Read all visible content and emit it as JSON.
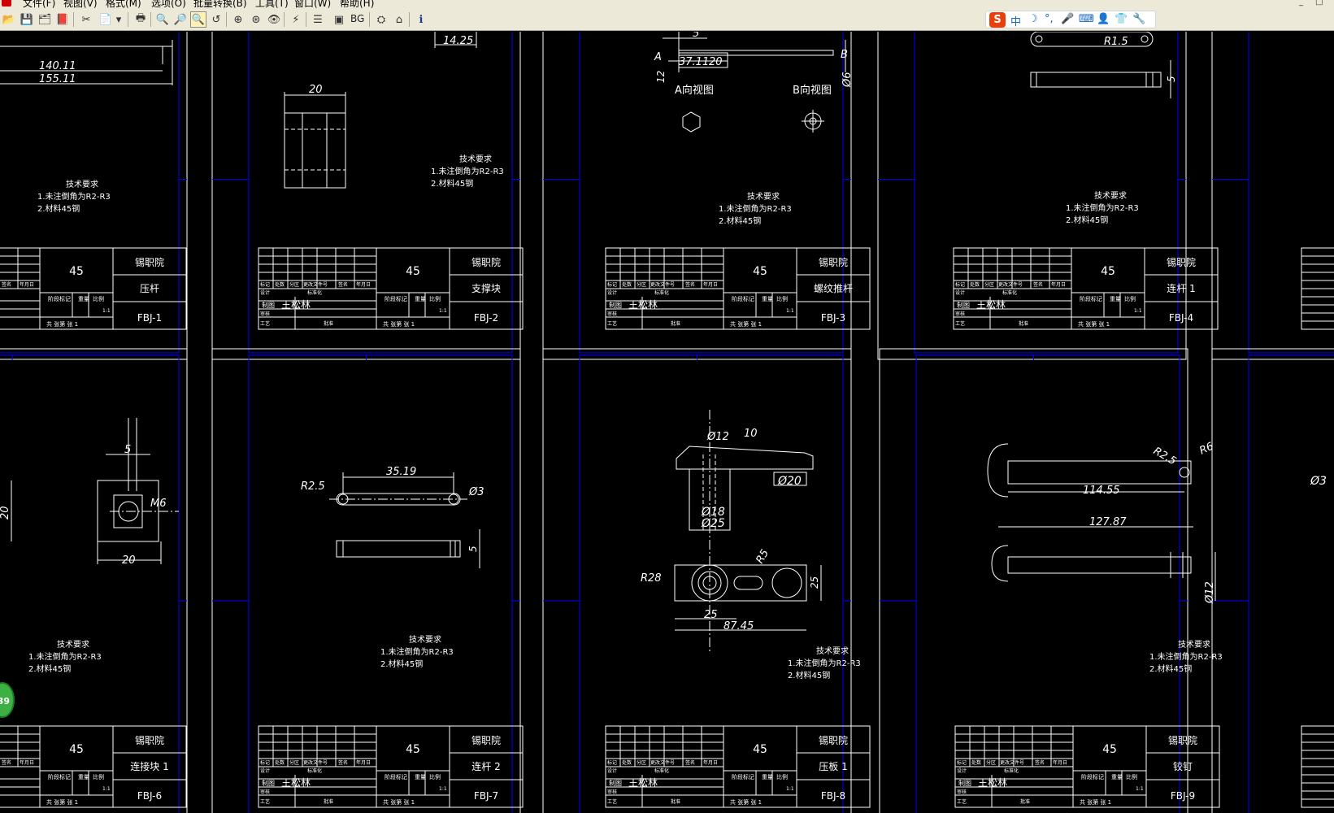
{
  "menu": {
    "items": [
      "文件(F)",
      "视图(V)",
      "格式(M)",
      "选项(O)",
      "批量转换(B)",
      "工具(T)",
      "窗口(W)",
      "帮助(H)"
    ],
    "window_controls": [
      "_",
      "□"
    ]
  },
  "toolbar": {
    "buttons": [
      {
        "name": "open-icon",
        "glyph": "📂"
      },
      {
        "name": "save-icon",
        "glyph": "💾"
      },
      {
        "name": "save-as-icon",
        "glyph": "🗂"
      },
      {
        "name": "export-icon",
        "glyph": "📕"
      },
      {
        "name": "convert-icon",
        "glyph": "✂"
      },
      {
        "name": "batch-icon",
        "glyph": "📄"
      },
      {
        "name": "dropdown-icon",
        "glyph": "▾"
      },
      {
        "name": "print-icon",
        "glyph": "🖶"
      },
      {
        "name": "zoom-out-icon",
        "glyph": "🔍"
      },
      {
        "name": "zoom-in-icon",
        "glyph": "🔎"
      },
      {
        "name": "zoom-window-icon",
        "glyph": "🔍"
      },
      {
        "name": "pan-icon",
        "glyph": "↺"
      },
      {
        "name": "zoom-extents-icon",
        "glyph": "⊕"
      },
      {
        "name": "zoom-previous-icon",
        "glyph": "⊛"
      },
      {
        "name": "view-icon",
        "glyph": "👁"
      },
      {
        "name": "measure-icon",
        "glyph": "⚡"
      },
      {
        "name": "layers-icon",
        "glyph": "☰"
      },
      {
        "name": "frame-icon",
        "glyph": "▣"
      },
      {
        "name": "bg-icon",
        "glyph": "BG"
      },
      {
        "name": "tools-icon",
        "glyph": "⛭"
      },
      {
        "name": "home-icon",
        "glyph": "⌂"
      },
      {
        "name": "info-icon",
        "glyph": "ℹ"
      }
    ]
  },
  "ime": {
    "logo": "S",
    "mode": "中",
    "icons": [
      "☽",
      "°,",
      "🎤",
      "⌨",
      "👤",
      "👕",
      "🔧"
    ]
  },
  "badge": "39",
  "colors": {
    "background": "#000000",
    "drawing_line": "#ffffff",
    "border_line": "#0000ff",
    "toolbar": "#ece9d8",
    "ime_logo": "#e8400c"
  },
  "tech_requirements": {
    "title": "技术要求",
    "line1": "1.未注倒角为R2-R3",
    "line2": "2.材料45钢"
  },
  "title_block": {
    "material": "45",
    "school": "锡职院",
    "drafter": "王松林",
    "draw_label": "制图",
    "set_label": "共 张第 张 1",
    "scale": "1:1",
    "stage_label": "阶段标记",
    "weight_label": "重量",
    "ratio_label": "比例",
    "mark_label": "标记",
    "count_label": "处数",
    "zone_label": "分区",
    "doc_label": "更改文件号",
    "sign_label": "签名",
    "date_label": "年月日",
    "design_label": "设计",
    "std_label": "标准化",
    "check_label": "审核",
    "process_label": "工艺",
    "approve_label": "批准"
  },
  "sheets": [
    {
      "id": "FBJ-1",
      "part": "压杆"
    },
    {
      "id": "FBJ-2",
      "part": "支撑块"
    },
    {
      "id": "FBJ-3",
      "part": "螺纹推杆"
    },
    {
      "id": "FBJ-4",
      "part": "连杆 1"
    },
    {
      "id": "FBJ-6",
      "part": "连接块 1"
    },
    {
      "id": "FBJ-7",
      "part": "连杆 2"
    },
    {
      "id": "FBJ-8",
      "part": "压板 1"
    },
    {
      "id": "FBJ-9",
      "part": "铰钉"
    }
  ],
  "dimensions": {
    "s1": [
      "140.11",
      "155.11"
    ],
    "s2": [
      "14.25",
      "20"
    ],
    "s3": [
      "5",
      "37.11",
      "20",
      "A",
      "B",
      "12",
      "Ø6",
      "A向视图",
      "B向视图"
    ],
    "s4": [
      "R1.5",
      "5"
    ],
    "s6": [
      "5",
      "M6",
      "20",
      "20"
    ],
    "s7": [
      "35.19",
      "R2.5",
      "Ø3",
      "5"
    ],
    "s8": [
      "Ø12",
      "10",
      "Ø20",
      "Ø18",
      "Ø25",
      "R5",
      "R28",
      "25",
      "25",
      "87.45"
    ],
    "s9": [
      "R2.5",
      "R6",
      "114.55",
      "127.87",
      "Ø12"
    ],
    "s10": [
      "Ø3"
    ]
  }
}
